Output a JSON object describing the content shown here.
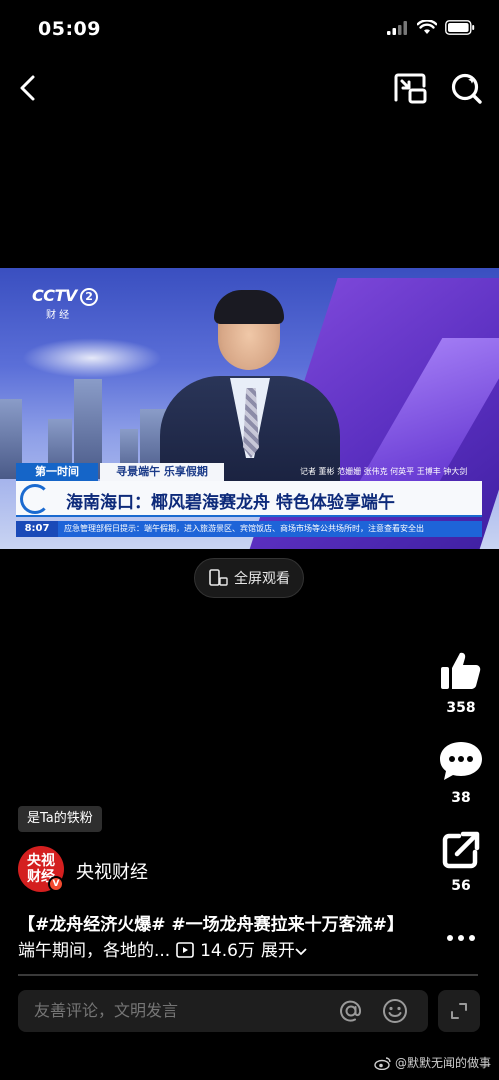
{
  "status_bar": {
    "time": "05:09"
  },
  "video": {
    "channel_logo": "CCTV",
    "channel_number": "2",
    "channel_sub": "财 经",
    "tag_first": "第一时间",
    "tag_topic": "寻景端午 乐享假期",
    "reporter_line": "记者 董彬 范姗姗 张伟克 何英平 王博丰 钟大剑",
    "headline": "海南海口：椰风碧海赛龙舟 特色体验享端午",
    "ticker_time": "8:07",
    "ticker_text": "应急管理部假日提示：端午假期，进入旅游景区、宾馆饭店、商场市场等公共场所时，注意查看安全出"
  },
  "fullscreen_button": {
    "label": "全屏观看"
  },
  "actions": {
    "like_count": "358",
    "comment_count": "38",
    "share_count": "56"
  },
  "author": {
    "fan_badge": "是Ta的铁粉",
    "avatar_text": "央视\n财经",
    "verified_mark": "V",
    "name": "央视财经"
  },
  "caption": {
    "hashtags": "【#龙舟经济火爆# #一场龙舟赛拉来十万客流#】",
    "text": "端午期间，各地的...",
    "views": "14.6万",
    "expand": "展开"
  },
  "comment_bar": {
    "placeholder": "友善评论，文明发言"
  },
  "watermark": {
    "text": "@默默无闻的做事"
  }
}
